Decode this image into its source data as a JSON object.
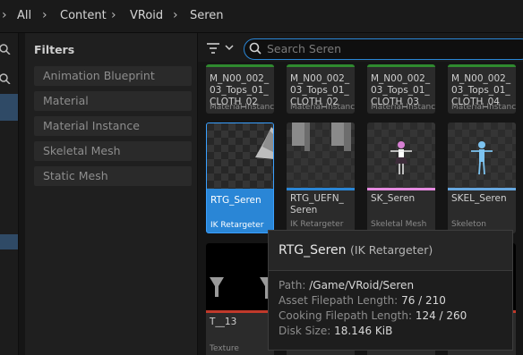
{
  "breadcrumb": [
    "All",
    "Content",
    "VRoid",
    "Seren"
  ],
  "filters": {
    "title": "Filters",
    "items": [
      "Animation Blueprint",
      "Material",
      "Material Instance",
      "Skeletal Mesh",
      "Static Mesh"
    ]
  },
  "search": {
    "placeholder": "Search Seren"
  },
  "assets": [
    {
      "name": "M_N00_002_\n03_Tops_01_\nCLOTH_02",
      "type": "Material Instance",
      "color": "#2f8a2f"
    },
    {
      "name": "M_N00_002_\n03_Tops_01_\nCLOTH_02",
      "type": "Material Instance",
      "color": "#2f8a2f"
    },
    {
      "name": "M_N00_002_\n03_Tops_01_\nCLOTH_03",
      "type": "Material Instance",
      "color": "#2f8a2f"
    },
    {
      "name": "M_N00_002_\n03_Tops_01_\nCLOTH_04",
      "type": "Material Instance",
      "color": "#2f8a2f"
    },
    {
      "name": "RTG_Seren",
      "type": "IK Retargeter",
      "color": "#2a86d6",
      "selected": true
    },
    {
      "name": "RTG_UEFN_\nSeren",
      "type": "IK Retargeter",
      "color": "#2a86d6"
    },
    {
      "name": "SK_Seren",
      "type": "Skeletal Mesh",
      "color": "#e58be0"
    },
    {
      "name": "SKEL_Seren",
      "type": "Skeleton",
      "color": "#67a8e0"
    },
    {
      "name": "T__13",
      "type": "Texture",
      "color": "#c0392b"
    },
    {
      "name": "",
      "type": "Texture",
      "color": "#c0392b"
    },
    {
      "name": "",
      "type": "Texture",
      "color": "#c0392b"
    },
    {
      "name": "",
      "type": "Texture",
      "color": "#c0392b"
    }
  ],
  "tooltip": {
    "name": "RTG_Seren",
    "kind": "(IK Retargeter)",
    "rows": [
      {
        "label": "Path:",
        "value": "/Game/VRoid/Seren"
      },
      {
        "label": "Asset Filepath Length:",
        "value": "76 / 210"
      },
      {
        "label": "Cooking Filepath Length:",
        "value": "124 / 260"
      },
      {
        "label": "Disk Size:",
        "value": "18.146 KiB"
      }
    ]
  }
}
